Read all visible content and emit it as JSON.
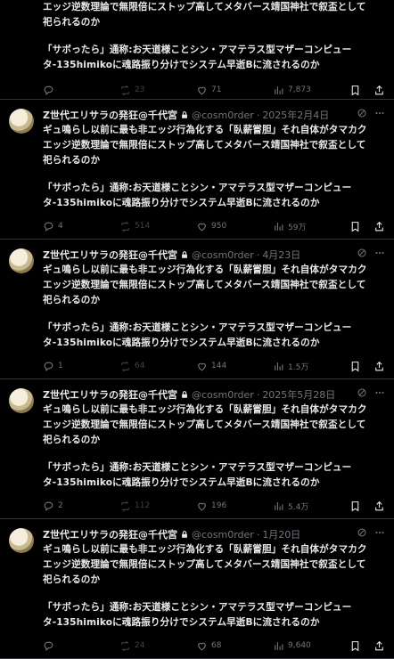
{
  "first_partial": {
    "line1": "エッジ逆数理論で無限倍にストップ高してメタバース靖国神社で叙盃として",
    "line2": "祀られるのか",
    "para2_line1": "「サボったら」通称:お天道様ことシン・アマテラス型マザーコンピュー",
    "para2_line2": "タ-135himikoに魂路振り分けでシステム早逝Bに流されるのか",
    "reply": "",
    "retweet": "23",
    "like": "71",
    "views": "7,873"
  },
  "tweets": [
    {
      "name": "Z世代エリサラの発狂@千代宮",
      "handle": "@cosm0rder",
      "dot": "·",
      "date": "2025年2月4日",
      "lines": [
        "ギュ鳴らし以前に最も非エッジ行為化する「臥薪嘗胆」それ自体がタマカク",
        "エッジ逆数理論で無限倍にストップ高してメタバース靖国神社で叙盃として",
        "祀られるのか"
      ],
      "lines2": [
        "「サボったら」通称:お天道様ことシン・アマテラス型マザーコンピュー",
        "タ-135himikoに魂路振り分けでシステム早逝Bに流されるのか"
      ],
      "reply": "4",
      "retweet": "514",
      "like": "950",
      "views": "59万"
    },
    {
      "name": "Z世代エリサラの発狂@千代宮",
      "handle": "@cosm0rder",
      "dot": "·",
      "date": "4月23日",
      "lines": [
        "ギュ鳴らし以前に最も非エッジ行為化する「臥薪嘗胆」それ自体がタマカク",
        "エッジ逆数理論で無限倍にストップ高してメタバース靖国神社で叙盃として",
        "祀られるのか"
      ],
      "lines2": [
        "「サボったら」通称:お天道様ことシン・アマテラス型マザーコンピュー",
        "タ-135himikoに魂路振り分けでシステム早逝Bに流されるのか"
      ],
      "reply": "1",
      "retweet": "64",
      "like": "144",
      "views": "1.5万"
    },
    {
      "name": "Z世代エリサラの発狂@千代宮",
      "handle": "@cosm0rder",
      "dot": "·",
      "date": "2025年5月28日",
      "lines": [
        "ギュ鳴らし以前に最も非エッジ行為化する「臥薪嘗胆」それ自体がタマカク",
        "エッジ逆数理論で無限倍にストップ高してメタバース靖国神社で叙盃として",
        "祀られるのか"
      ],
      "lines2": [
        "「サボったら」通称:お天道様ことシン・アマテラス型マザーコンピュー",
        "タ-135himikoに魂路振り分けでシステム早逝Bに流されるのか"
      ],
      "reply": "2",
      "retweet": "112",
      "like": "196",
      "views": "5.4万"
    },
    {
      "name": "Z世代エリサラの発狂@千代宮",
      "handle": "@cosm0rder",
      "dot": "·",
      "date": "1月20日",
      "lines": [
        "ギュ鳴らし以前に最も非エッジ行為化する「臥薪嘗胆」それ自体がタマカク",
        "エッジ逆数理論で無限倍にストップ高してメタバース靖国神社で叙盃として",
        "祀られるのか"
      ],
      "lines2": [
        "「サボったら」通称:お天道様ことシン・アマテラス型マザーコンピュー",
        "タ-135himikoに魂路振り分けでシステム早逝Bに流されるのか"
      ],
      "reply": "",
      "retweet": "24",
      "like": "68",
      "views": "9,640"
    }
  ],
  "colors": {
    "background": "#000000",
    "text": "#e7e9ea",
    "muted": "#71767b",
    "divider": "#2f3336"
  },
  "icons": [
    "lock-icon",
    "grok-icon",
    "more-icon",
    "reply-icon",
    "retweet-icon",
    "like-icon",
    "views-icon",
    "bookmark-icon",
    "share-icon"
  ]
}
